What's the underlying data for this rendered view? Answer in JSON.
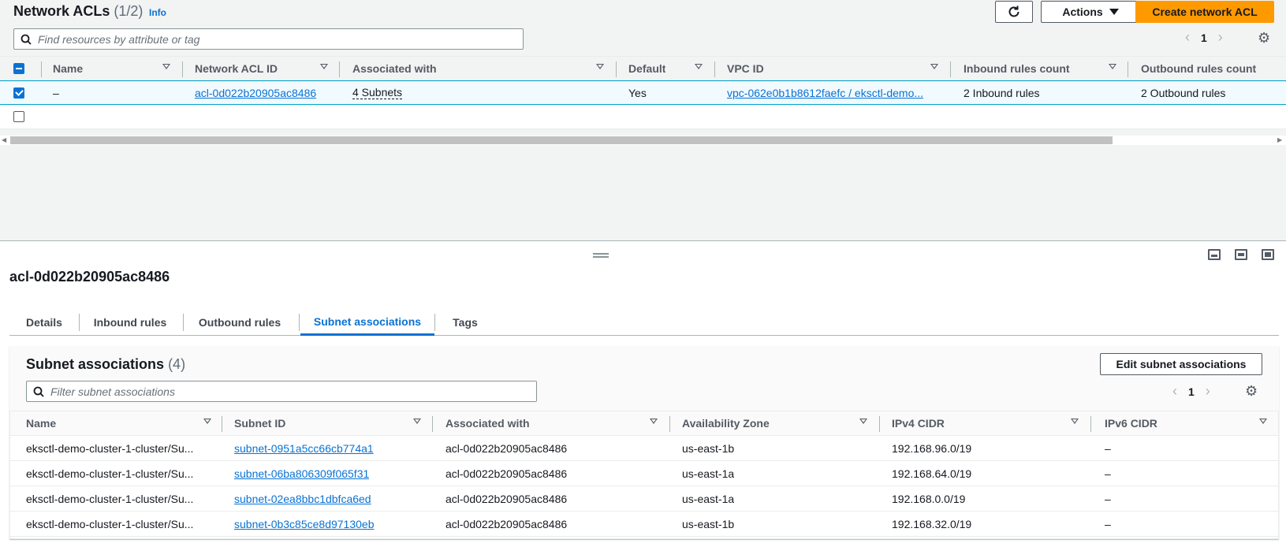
{
  "top": {
    "title": "Network ACLs",
    "count": "(1/2)",
    "info": "Info",
    "actions_label": "Actions",
    "create_label": "Create network ACL",
    "search_placeholder": "Find resources by attribute or tag",
    "page": "1",
    "columns": [
      "Name",
      "Network ACL ID",
      "Associated with",
      "Default",
      "VPC ID",
      "Inbound rules count",
      "Outbound rules count"
    ],
    "rows": [
      {
        "name": "–",
        "acl_id": "acl-0d022b20905ac8486",
        "associated": "4 Subnets",
        "default": "Yes",
        "vpc_id": "vpc-062e0b1b8612faefc / eksctl-demo...",
        "inbound": "2 Inbound rules",
        "outbound": "2 Outbound rules"
      }
    ]
  },
  "detail": {
    "title": "acl-0d022b20905ac8486",
    "tabs": [
      "Details",
      "Inbound rules",
      "Outbound rules",
      "Subnet associations",
      "Tags"
    ],
    "active_tab": "Subnet associations"
  },
  "subnets": {
    "title": "Subnet associations",
    "count": "(4)",
    "edit_label": "Edit subnet associations",
    "filter_placeholder": "Filter subnet associations",
    "page": "1",
    "columns": [
      "Name",
      "Subnet ID",
      "Associated with",
      "Availability Zone",
      "IPv4 CIDR",
      "IPv6 CIDR"
    ],
    "rows": [
      {
        "name": "eksctl-demo-cluster-1-cluster/Su...",
        "subnet_id": "subnet-0951a5cc66cb774a1",
        "associated": "acl-0d022b20905ac8486",
        "az": "us-east-1b",
        "ipv4": "192.168.96.0/19",
        "ipv6": "–"
      },
      {
        "name": "eksctl-demo-cluster-1-cluster/Su...",
        "subnet_id": "subnet-06ba806309f065f31",
        "associated": "acl-0d022b20905ac8486",
        "az": "us-east-1a",
        "ipv4": "192.168.64.0/19",
        "ipv6": "–"
      },
      {
        "name": "eksctl-demo-cluster-1-cluster/Su...",
        "subnet_id": "subnet-02ea8bbc1dbfca6ed",
        "associated": "acl-0d022b20905ac8486",
        "az": "us-east-1a",
        "ipv4": "192.168.0.0/19",
        "ipv6": "–"
      },
      {
        "name": "eksctl-demo-cluster-1-cluster/Su...",
        "subnet_id": "subnet-0b3c85ce8d97130eb",
        "associated": "acl-0d022b20905ac8486",
        "az": "us-east-1b",
        "ipv4": "192.168.32.0/19",
        "ipv6": "–"
      }
    ]
  },
  "icons": {
    "refresh": "refresh-icon",
    "caret": "caret-down-icon",
    "search": "search-icon",
    "settings": "gear-icon",
    "prev": "chevron-left-icon",
    "next": "chevron-right-icon"
  },
  "colors": {
    "primary": "#ff9900",
    "link": "#0972d3",
    "selected_row": "#f1faff",
    "selected_border": "#00a1c9"
  }
}
